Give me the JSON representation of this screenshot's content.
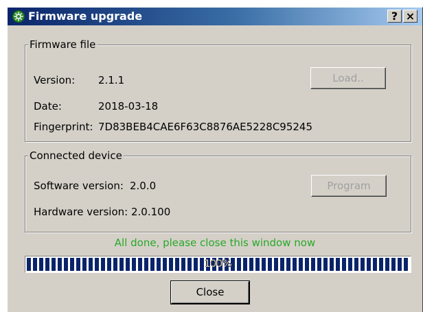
{
  "window": {
    "title": "Firmware upgrade",
    "help_label": "?",
    "close_label": "×"
  },
  "firmware_file": {
    "group_title": "Firmware file",
    "version_label": "Version:",
    "version_value": "2.1.1",
    "date_label": "Date:",
    "date_value": "2018-03-18",
    "fingerprint_label": "Fingerprint:",
    "fingerprint_value": "7D83BEB4CAE6F63C8876AE5228C95245",
    "load_button": "Load.."
  },
  "connected_device": {
    "group_title": "Connected device",
    "software_label": "Software version:",
    "software_value": "2.0.0",
    "hardware_label": "Hardware version:",
    "hardware_value": "2.0.100",
    "program_button": "Program"
  },
  "status": {
    "message": "All done, please close this window now",
    "color": "#27a827"
  },
  "progress": {
    "percent": 100,
    "label": "100%"
  },
  "close_button": "Close",
  "icons": {
    "title_icon": "gear-icon"
  }
}
